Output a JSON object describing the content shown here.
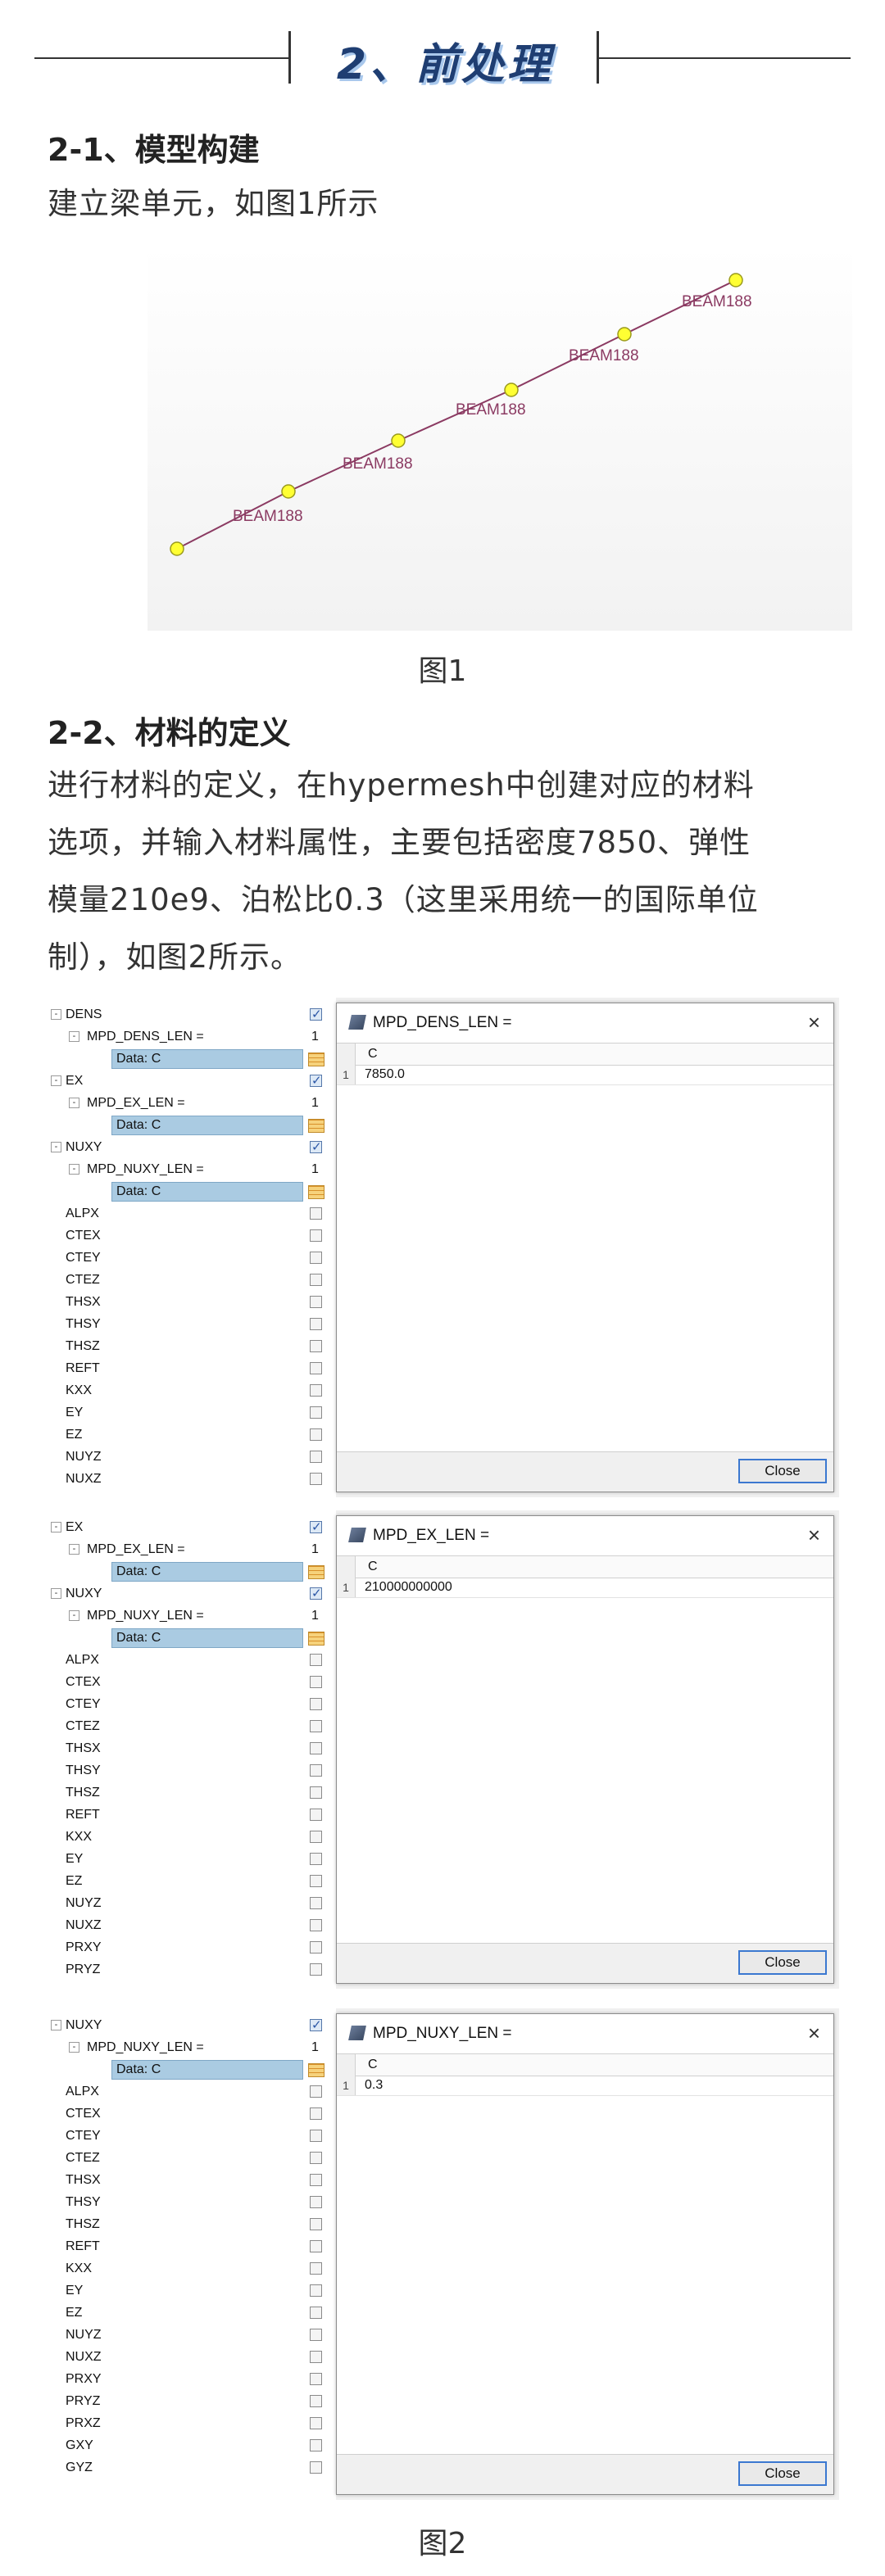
{
  "section": {
    "title": "2、前处理"
  },
  "s21": {
    "heading": "2-1、模型构建",
    "text": "建立梁单元，如图1所示",
    "figure": {
      "labels": [
        "BEAM188",
        "BEAM188",
        "BEAM188",
        "BEAM188",
        "BEAM188"
      ],
      "caption": "图1"
    }
  },
  "s22": {
    "heading": "2-2、材料的定义",
    "lines": [
      "进行材料的定义，在hypermesh中创建对应的材料",
      "选项，并输入材料属性，主要包括密度7850、弹性",
      "模量210e9、泊松比0.3（这里采用统一的国际单位",
      "制），如图2所示。"
    ]
  },
  "shot1": {
    "tree": [
      {
        "label": "DENS",
        "expander": "⊟"
      },
      {
        "label": "MPD_DENS_LEN =",
        "expander": "⊟",
        "num": "1"
      },
      {
        "label": "Data: C"
      },
      {
        "label": "EX",
        "expander": "⊟"
      },
      {
        "label": "MPD_EX_LEN =",
        "expander": "⊟",
        "num": "1"
      },
      {
        "label": "Data: C"
      },
      {
        "label": "NUXY",
        "expander": "⊟"
      },
      {
        "label": "MPD_NUXY_LEN =",
        "expander": "⊟",
        "num": "1"
      },
      {
        "label": "Data: C"
      },
      {
        "label": "ALPX"
      },
      {
        "label": "CTEX"
      },
      {
        "label": "CTEY"
      },
      {
        "label": "CTEZ"
      },
      {
        "label": "THSX"
      },
      {
        "label": "THSY"
      },
      {
        "label": "THSZ"
      },
      {
        "label": "REFT"
      },
      {
        "label": "KXX"
      },
      {
        "label": "EY"
      },
      {
        "label": "EZ"
      },
      {
        "label": "NUYZ"
      },
      {
        "label": "NUXZ"
      }
    ],
    "dialog": {
      "title": "MPD_DENS_LEN =",
      "column": "C",
      "row_index": "1",
      "value": "7850.0",
      "close": "Close",
      "close_icon": "×"
    }
  },
  "shot2": {
    "tree": [
      {
        "label": "EX",
        "expander": "⊟"
      },
      {
        "label": "MPD_EX_LEN =",
        "expander": "⊟",
        "num": "1"
      },
      {
        "label": "Data: C"
      },
      {
        "label": "NUXY",
        "expander": "⊟"
      },
      {
        "label": "MPD_NUXY_LEN =",
        "expander": "⊟",
        "num": "1"
      },
      {
        "label": "Data: C"
      },
      {
        "label": "ALPX"
      },
      {
        "label": "CTEX"
      },
      {
        "label": "CTEY"
      },
      {
        "label": "CTEZ"
      },
      {
        "label": "THSX"
      },
      {
        "label": "THSY"
      },
      {
        "label": "THSZ"
      },
      {
        "label": "REFT"
      },
      {
        "label": "KXX"
      },
      {
        "label": "EY"
      },
      {
        "label": "EZ"
      },
      {
        "label": "NUYZ"
      },
      {
        "label": "NUXZ"
      },
      {
        "label": "PRXY"
      },
      {
        "label": "PRYZ"
      }
    ],
    "dialog": {
      "title": "MPD_EX_LEN =",
      "column": "C",
      "row_index": "1",
      "value": "210000000000",
      "close": "Close",
      "close_icon": "×"
    }
  },
  "shot3": {
    "tree": [
      {
        "label": "NUXY",
        "expander": "⊟"
      },
      {
        "label": "MPD_NUXY_LEN =",
        "expander": "⊟",
        "num": "1"
      },
      {
        "label": "Data: C"
      },
      {
        "label": "ALPX"
      },
      {
        "label": "CTEX"
      },
      {
        "label": "CTEY"
      },
      {
        "label": "CTEZ"
      },
      {
        "label": "THSX"
      },
      {
        "label": "THSY"
      },
      {
        "label": "THSZ"
      },
      {
        "label": "REFT"
      },
      {
        "label": "KXX"
      },
      {
        "label": "EY"
      },
      {
        "label": "EZ"
      },
      {
        "label": "NUYZ"
      },
      {
        "label": "NUXZ"
      },
      {
        "label": "PRXY"
      },
      {
        "label": "PRYZ"
      },
      {
        "label": "PRXZ"
      },
      {
        "label": "GXY"
      },
      {
        "label": "GYZ"
      }
    ],
    "dialog": {
      "title": "MPD_NUXY_LEN =",
      "column": "C",
      "row_index": "1",
      "value": "0.3",
      "close": "Close",
      "close_icon": "×"
    }
  },
  "fig2_caption": "图2",
  "colors": {
    "title": "#1f3e72",
    "title_shadow": "#a9c8ec",
    "beam": "#8b3a62",
    "node": "#ffff33"
  }
}
